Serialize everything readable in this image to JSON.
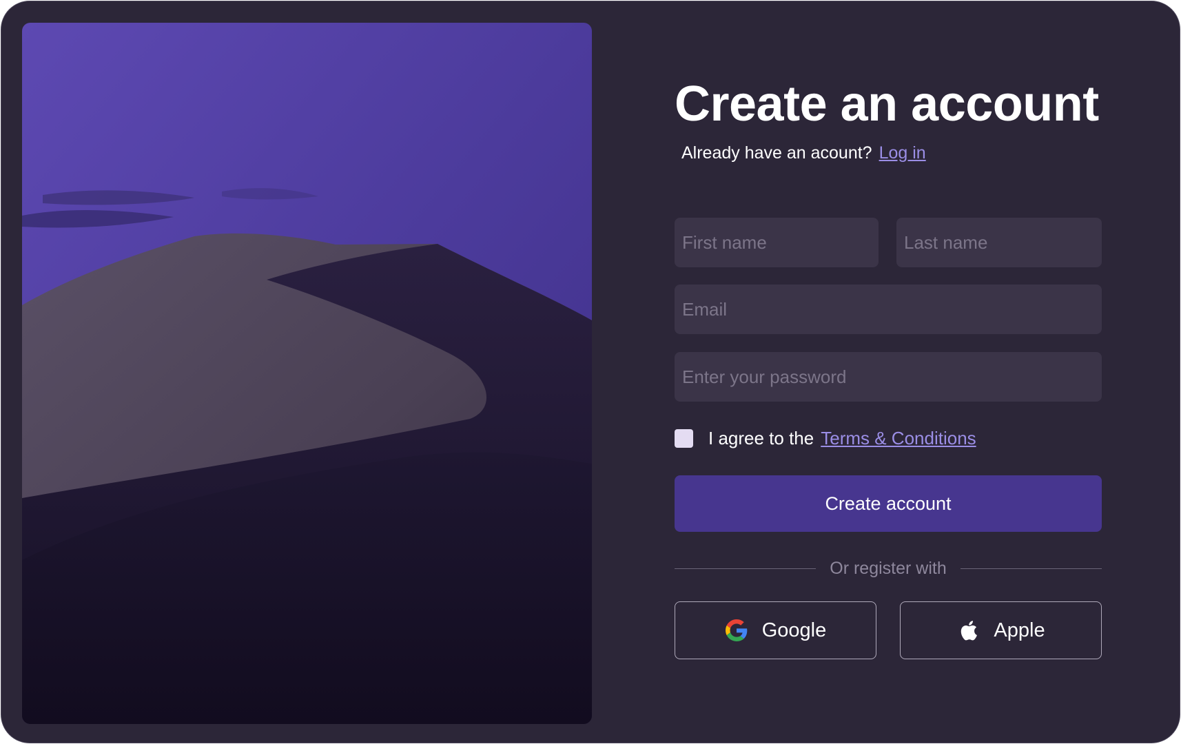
{
  "signup": {
    "title": "Create an account",
    "login_prompt": "Already have an acount?",
    "login_link": "Log in",
    "first_name_placeholder": "First name",
    "last_name_placeholder": "Last name",
    "email_placeholder": "Email",
    "password_placeholder": "Enter your password",
    "agree_text": "I agree to the",
    "terms_link": "Terms & Conditions",
    "terms_checked": false,
    "submit_label": "Create account",
    "divider_text": "Or register with",
    "social": {
      "google_label": "Google",
      "google_icon": "google-icon",
      "apple_label": "Apple",
      "apple_icon": "apple-icon"
    }
  },
  "hero_image": {
    "description_icon": "desert-dune-image"
  },
  "colors": {
    "background": "#2c2638",
    "input_background": "#3b3448",
    "accent": "#47368f",
    "link": "#9b8ee6"
  }
}
